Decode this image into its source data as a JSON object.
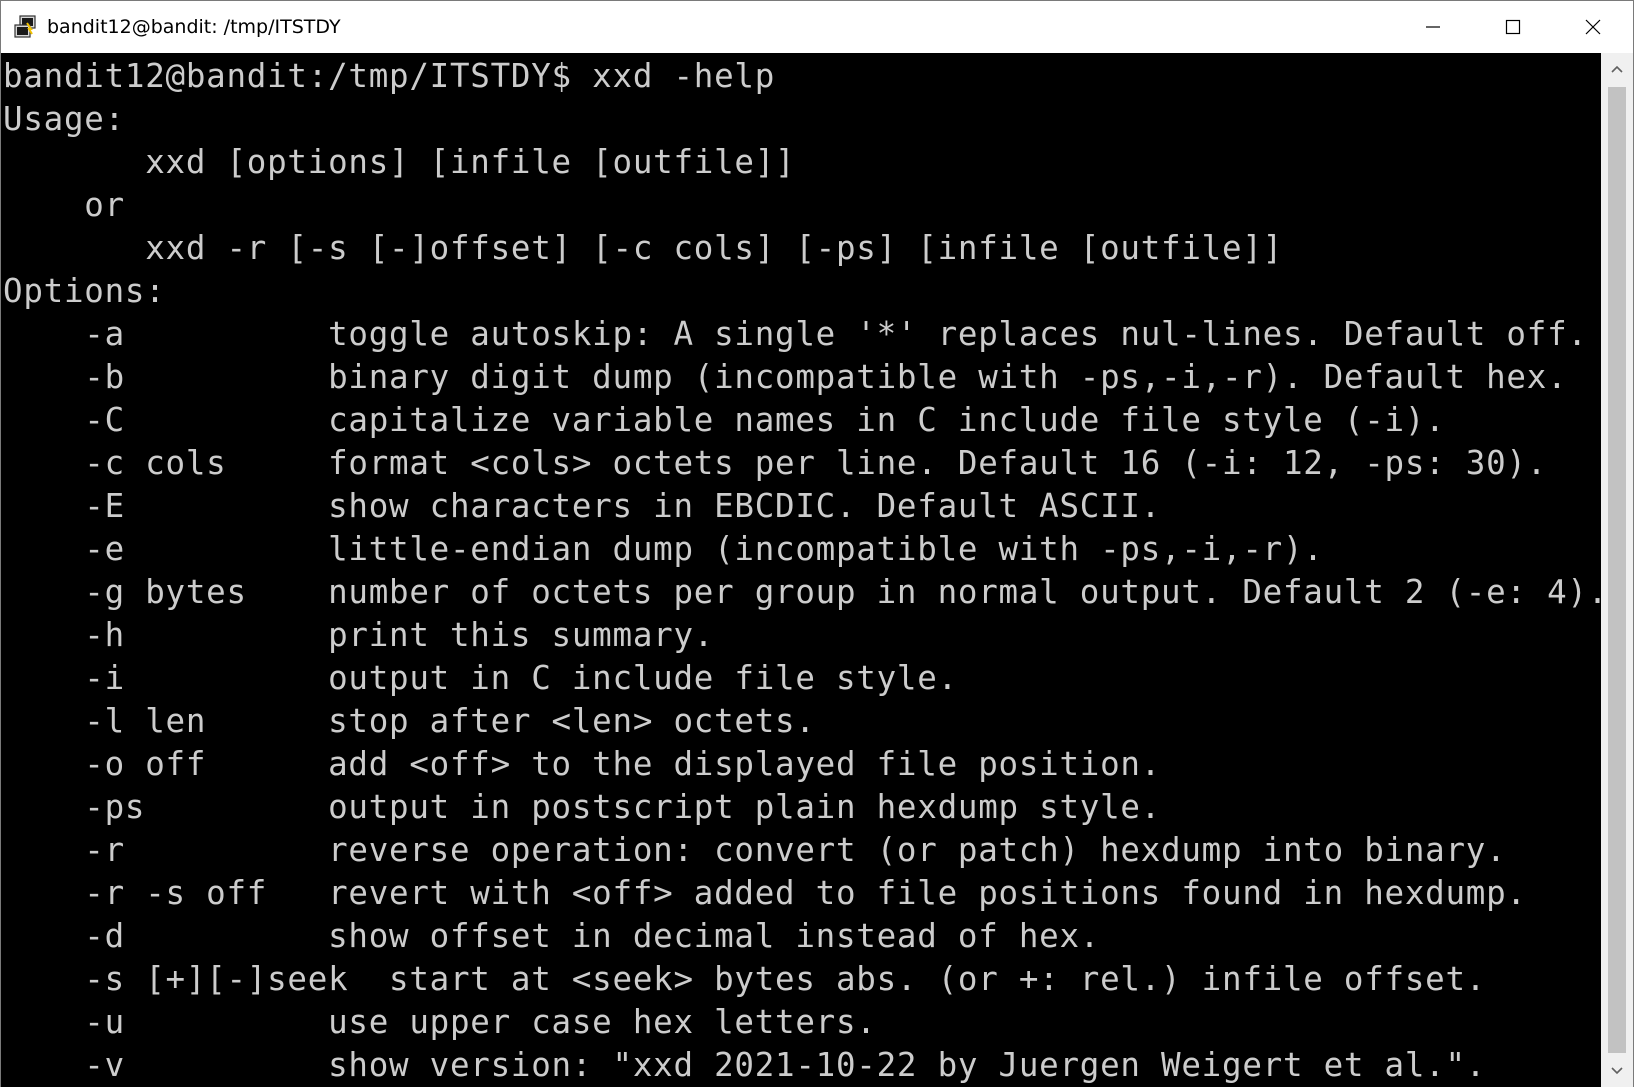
{
  "window": {
    "title": "bandit12@bandit: /tmp/ITSTDY",
    "icons": {
      "app": "putty-terminal-icon",
      "minimize": "minimize-icon",
      "maximize": "maximize-icon",
      "close": "close-icon",
      "scroll_up": "chevron-up-icon",
      "scroll_down": "chevron-down-icon"
    }
  },
  "terminal": {
    "colors": {
      "background": "#000000",
      "foreground": "#cccccc"
    },
    "lines": [
      "bandit12@bandit:/tmp/ITSTDY$ xxd -help",
      "Usage:",
      "       xxd [options] [infile [outfile]]",
      "    or",
      "       xxd -r [-s [-]offset] [-c cols] [-ps] [infile [outfile]]",
      "Options:",
      "    -a          toggle autoskip: A single '*' replaces nul-lines. Default off.",
      "    -b          binary digit dump (incompatible with -ps,-i,-r). Default hex.",
      "    -C          capitalize variable names in C include file style (-i).",
      "    -c cols     format <cols> octets per line. Default 16 (-i: 12, -ps: 30).",
      "    -E          show characters in EBCDIC. Default ASCII.",
      "    -e          little-endian dump (incompatible with -ps,-i,-r).",
      "    -g bytes    number of octets per group in normal output. Default 2 (-e: 4).",
      "    -h          print this summary.",
      "    -i          output in C include file style.",
      "    -l len      stop after <len> octets.",
      "    -o off      add <off> to the displayed file position.",
      "    -ps         output in postscript plain hexdump style.",
      "    -r          reverse operation: convert (or patch) hexdump into binary.",
      "    -r -s off   revert with <off> added to file positions found in hexdump.",
      "    -d          show offset in decimal instead of hex.",
      "    -s [+][-]seek  start at <seek> bytes abs. (or +: rel.) infile offset.",
      "    -u          use upper case hex letters.",
      "    -v          show version: \"xxd 2021-10-22 by Juergen Weigert et al.\"."
    ]
  }
}
